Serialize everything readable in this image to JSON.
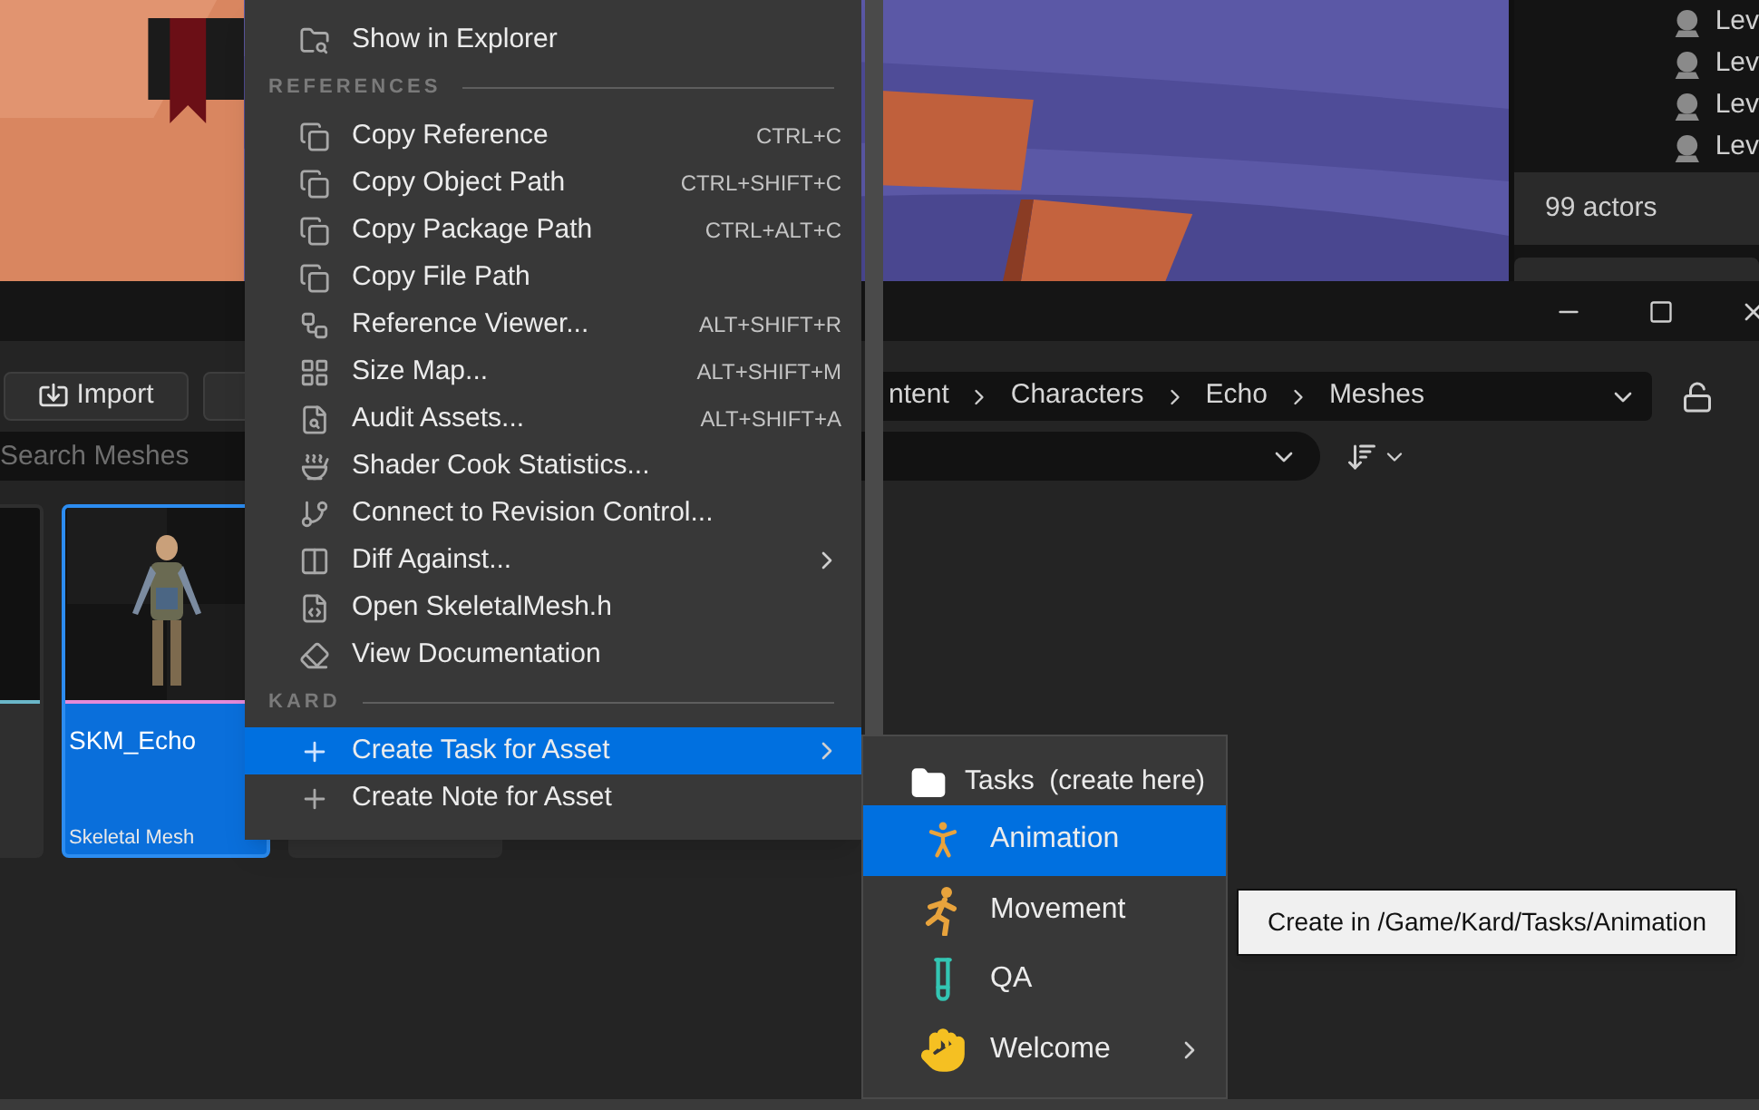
{
  "outliner": {
    "items": [
      "Lev",
      "Lev",
      "Lev",
      "Lev"
    ],
    "actor_count": "99 actors"
  },
  "content_browser": {
    "import_button": "Import",
    "breadcrumbs": [
      "ntent",
      "Characters",
      "Echo",
      "Meshes"
    ],
    "search": {
      "placeholder": "Search Meshes"
    },
    "assets": [
      {
        "selected": false
      },
      {
        "name": "SKM_Echo",
        "type": "Skeletal Mesh",
        "selected": true
      },
      {
        "selected": false
      }
    ]
  },
  "context_menu": {
    "sections": [
      {
        "items": [
          {
            "label": "Show in Explorer"
          }
        ]
      },
      {
        "heading": "REFERENCES",
        "items": [
          {
            "label": "Copy Reference",
            "shortcut": "CTRL+C"
          },
          {
            "label": "Copy Object Path",
            "shortcut": "CTRL+SHIFT+C"
          },
          {
            "label": "Copy Package Path",
            "shortcut": "CTRL+ALT+C"
          },
          {
            "label": "Copy File Path"
          },
          {
            "label": "Reference Viewer...",
            "shortcut": "ALT+SHIFT+R"
          },
          {
            "label": "Size Map...",
            "shortcut": "ALT+SHIFT+M"
          },
          {
            "label": "Audit Assets...",
            "shortcut": "ALT+SHIFT+A"
          },
          {
            "label": "Shader Cook Statistics..."
          },
          {
            "label": "Connect to Revision Control..."
          },
          {
            "label": "Diff Against...",
            "submenu": true
          },
          {
            "label": "Open SkeletalMesh.h"
          },
          {
            "label": "View Documentation"
          }
        ]
      },
      {
        "heading": "KARD",
        "items": [
          {
            "label": "Create Task for Asset",
            "submenu": true,
            "selected": true
          },
          {
            "label": "Create Note for Asset",
            "selected": false
          }
        ]
      }
    ]
  },
  "submenu": {
    "heading": "Tasks  (create here)",
    "items": [
      {
        "label": "Animation",
        "selected": true
      },
      {
        "label": "Movement",
        "selected": false
      },
      {
        "label": "QA",
        "selected": false
      },
      {
        "label": "Welcome",
        "selected": false,
        "submenu": true
      }
    ]
  },
  "tooltip": {
    "text": "Create in /Game/Kard/Tasks/Animation"
  }
}
